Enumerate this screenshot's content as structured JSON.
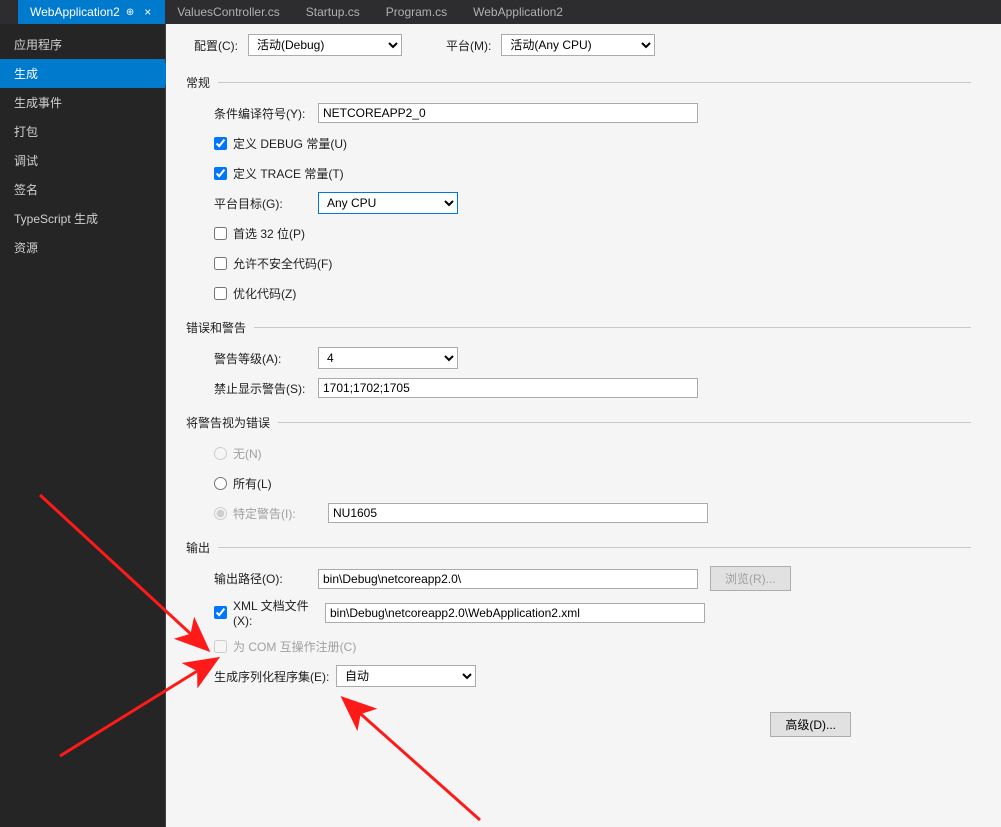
{
  "tabs": [
    {
      "label": "WebApplication2",
      "active": true,
      "pinned": true,
      "closable": true
    },
    {
      "label": "ValuesController.cs",
      "active": false
    },
    {
      "label": "Startup.cs",
      "active": false
    },
    {
      "label": "Program.cs",
      "active": false
    },
    {
      "label": "WebApplication2",
      "active": false
    }
  ],
  "sidebar": {
    "items": [
      {
        "label": "应用程序"
      },
      {
        "label": "生成",
        "active": true
      },
      {
        "label": "生成事件"
      },
      {
        "label": "打包"
      },
      {
        "label": "调试"
      },
      {
        "label": "签名"
      },
      {
        "label": "TypeScript 生成"
      },
      {
        "label": "资源"
      }
    ]
  },
  "topbar": {
    "config_label": "配置(C):",
    "config_value": "活动(Debug)",
    "platform_label": "平台(M):",
    "platform_value": "活动(Any CPU)"
  },
  "sections": {
    "general": {
      "title": "常规",
      "cond_symbols_label": "条件编译符号(Y):",
      "cond_symbols_value": "NETCOREAPP2_0",
      "define_debug": "定义 DEBUG 常量(U)",
      "define_trace": "定义 TRACE 常量(T)",
      "platform_target_label": "平台目标(G):",
      "platform_target_value": "Any CPU",
      "prefer_32": "首选 32 位(P)",
      "allow_unsafe": "允许不安全代码(F)",
      "optimize": "优化代码(Z)"
    },
    "errors": {
      "title": "错误和警告",
      "warn_level_label": "警告等级(A):",
      "warn_level_value": "4",
      "suppress_label": "禁止显示警告(S):",
      "suppress_value": "1701;1702;1705"
    },
    "treat_warn": {
      "title": "将警告视为错误",
      "none": "无(N)",
      "all": "所有(L)",
      "specific": "特定警告(I):",
      "specific_value": "NU1605"
    },
    "output": {
      "title": "输出",
      "out_path_label": "输出路径(O):",
      "out_path_value": "bin\\Debug\\netcoreapp2.0\\",
      "browse": "浏览(R)...",
      "xml_doc_label": "XML 文档文件(X):",
      "xml_doc_value": "bin\\Debug\\netcoreapp2.0\\WebApplication2.xml",
      "com_register": "为 COM 互操作注册(C)",
      "serialization_label": "生成序列化程序集(E):",
      "serialization_value": "自动"
    },
    "advanced_btn": "高级(D)..."
  }
}
